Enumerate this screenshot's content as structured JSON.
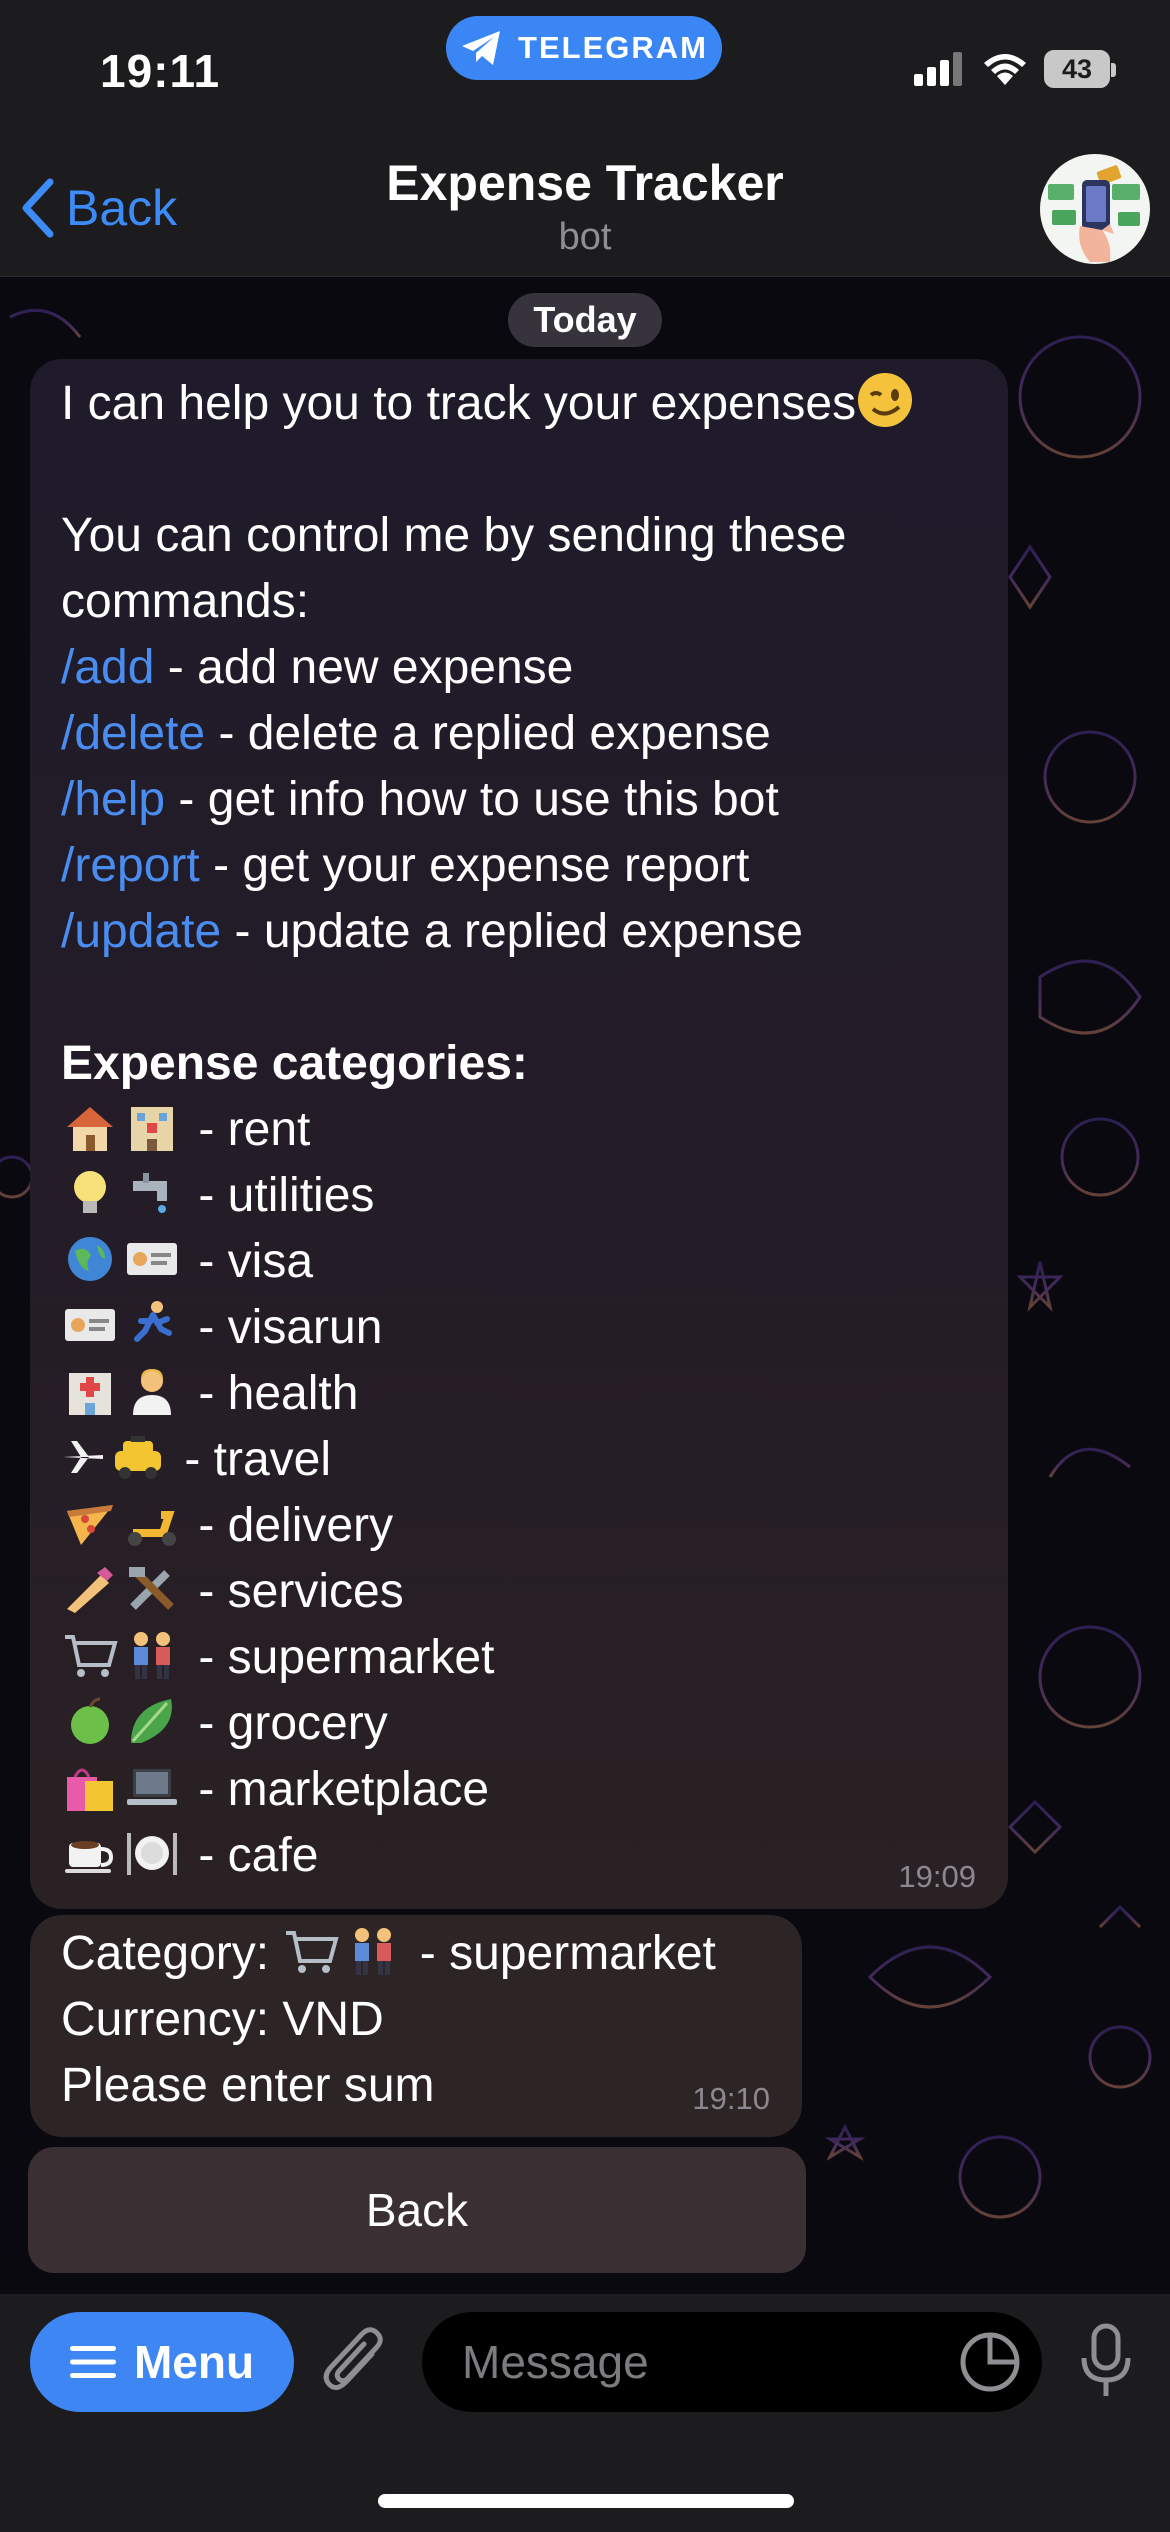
{
  "status_bar": {
    "time": "19:11",
    "telegram_pill": "TELEGRAM",
    "battery": "43"
  },
  "nav": {
    "back_label": "Back",
    "title": "Expense Tracker",
    "subtitle": "bot"
  },
  "chat": {
    "date_chip": "Today",
    "message1": {
      "intro": "I can help you to track your expenses",
      "control_line1": "You can control me by sending these",
      "control_line2": "commands:",
      "commands": [
        {
          "cmd": "/add",
          "desc": " - add new expense"
        },
        {
          "cmd": "/delete",
          "desc": " - delete a replied expense"
        },
        {
          "cmd": "/help",
          "desc": " - get info how to use this bot"
        },
        {
          "cmd": "/report",
          "desc": " - get your expense report"
        },
        {
          "cmd": "/update",
          "desc": " - update a replied expense"
        }
      ],
      "categories_header": "Expense categories:",
      "categories": [
        {
          "icons": [
            "house-emoji",
            "hotel-emoji"
          ],
          "label": "- rent"
        },
        {
          "icons": [
            "light-bulb-emoji",
            "faucet-emoji"
          ],
          "label": "- utilities"
        },
        {
          "icons": [
            "globe-emoji",
            "id-card-emoji"
          ],
          "label": "- visa"
        },
        {
          "icons": [
            "id-card-emoji",
            "runner-emoji"
          ],
          "label": "- visarun"
        },
        {
          "icons": [
            "hospital-emoji",
            "health-worker-emoji"
          ],
          "label": "- health"
        },
        {
          "icons": [
            "airplane-emoji",
            "taxi-emoji"
          ],
          "label": "- travel"
        },
        {
          "icons": [
            "pizza-emoji",
            "scooter-emoji"
          ],
          "label": "- delivery"
        },
        {
          "icons": [
            "nail-polish-emoji",
            "tools-emoji"
          ],
          "label": "- services"
        },
        {
          "icons": [
            "cart-emoji",
            "couple-emoji"
          ],
          "label": "- supermarket"
        },
        {
          "icons": [
            "apple-emoji",
            "leafy-green-emoji"
          ],
          "label": "- grocery"
        },
        {
          "icons": [
            "shopping-bags-emoji",
            "laptop-emoji"
          ],
          "label": "- marketplace"
        },
        {
          "icons": [
            "coffee-emoji",
            "plate-emoji"
          ],
          "label": "- cafe"
        }
      ],
      "time": "19:09"
    },
    "message2": {
      "category_label": "Category:",
      "category_value": "- supermarket",
      "currency": "Currency: VND",
      "prompt": "Please enter sum",
      "time": "19:10"
    },
    "keyboard_button": "Back"
  },
  "input_bar": {
    "menu_label": "Menu",
    "placeholder": "Message"
  },
  "colors": {
    "accent": "#3d86f4",
    "link": "#4a8df0",
    "bar_bg": "#1c1c1e",
    "bubble_bg": "#221c28"
  }
}
